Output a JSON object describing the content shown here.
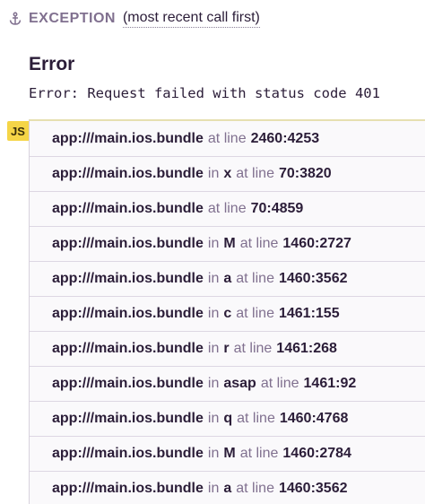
{
  "header": {
    "exception_label": "EXCEPTION",
    "recent_label": "(most recent call first)"
  },
  "error": {
    "title": "Error",
    "message": "Error: Request failed with status code 401"
  },
  "platform_badge": "JS",
  "words": {
    "in": "in",
    "at_line": "at line"
  },
  "frames": [
    {
      "file": "app:///main.ios.bundle",
      "function": "",
      "location": "2460:4253"
    },
    {
      "file": "app:///main.ios.bundle",
      "function": "x",
      "location": "70:3820"
    },
    {
      "file": "app:///main.ios.bundle",
      "function": "",
      "location": "70:4859"
    },
    {
      "file": "app:///main.ios.bundle",
      "function": "M",
      "location": "1460:2727"
    },
    {
      "file": "app:///main.ios.bundle",
      "function": "a",
      "location": "1460:3562"
    },
    {
      "file": "app:///main.ios.bundle",
      "function": "c",
      "location": "1461:155"
    },
    {
      "file": "app:///main.ios.bundle",
      "function": "r",
      "location": "1461:268"
    },
    {
      "file": "app:///main.ios.bundle",
      "function": "asap",
      "location": "1461:92"
    },
    {
      "file": "app:///main.ios.bundle",
      "function": "q",
      "location": "1460:4768"
    },
    {
      "file": "app:///main.ios.bundle",
      "function": "M",
      "location": "1460:2784"
    },
    {
      "file": "app:///main.ios.bundle",
      "function": "a",
      "location": "1460:3562"
    }
  ],
  "colors": {
    "text": "#2b1d38",
    "muted": "#80708f",
    "badge": "#f5d547",
    "frame_bg": "#faf9fb"
  },
  "icons": {
    "exception": "anchor-icon"
  }
}
